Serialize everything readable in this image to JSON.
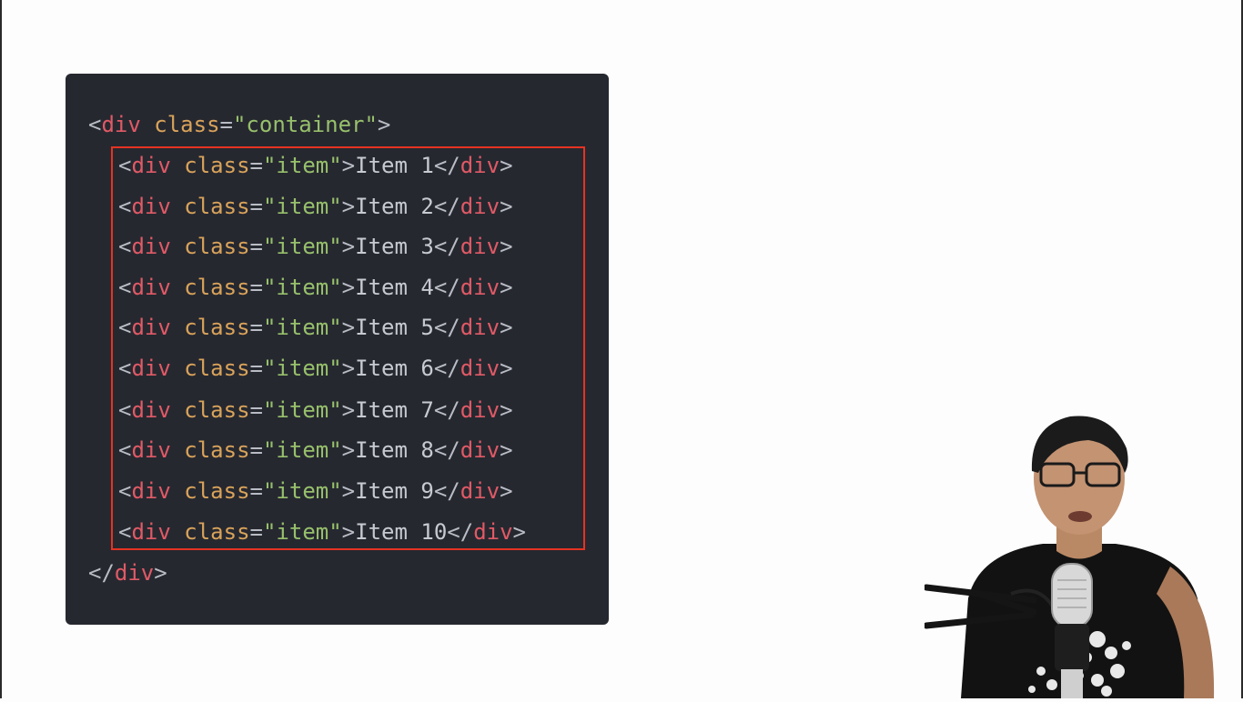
{
  "colors": {
    "background": "#fdfdfd",
    "code_bg": "#262830",
    "tag": "#e05a66",
    "attr": "#d9a35a",
    "string": "#97c06b",
    "punct": "#b9bcc4",
    "highlight": "#e63322"
  },
  "code": {
    "open": {
      "lt": "<",
      "tag": "div",
      "attr": "class",
      "eq": "=",
      "value": "\"container\"",
      "gt": ">"
    },
    "items": [
      {
        "value": "\"item\"",
        "text": "Item 1"
      },
      {
        "value": "\"item\"",
        "text": "Item 2"
      },
      {
        "value": "\"item\"",
        "text": "Item 3"
      },
      {
        "value": "\"item\"",
        "text": "Item 4"
      },
      {
        "value": "\"item\"",
        "text": "Item 5"
      },
      {
        "value": "\"item\"",
        "text": "Item 6"
      },
      {
        "value": "\"item\"",
        "text": "Item 7"
      },
      {
        "value": "\"item\"",
        "text": "Item 8"
      },
      {
        "value": "\"item\"",
        "text": "Item 9"
      },
      {
        "value": "\"item\"",
        "text": "Item 10"
      }
    ],
    "close": {
      "lt": "</",
      "tag": "div",
      "gt": ">"
    }
  },
  "presenter": {
    "icon": "presenter-video-icon"
  }
}
